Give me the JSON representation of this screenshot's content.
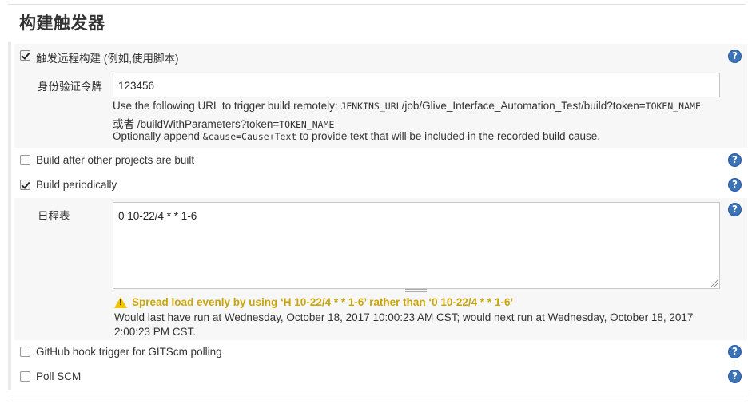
{
  "section": {
    "title": "构建触发器"
  },
  "remote_trigger": {
    "label": "触发远程构建 (例如,使用脚本)",
    "checked": true,
    "token_label": "身份验证令牌",
    "token_value": "123456",
    "desc_line1_prefix": "Use the following URL to trigger build remotely: ",
    "desc_line1_mono": "JENKINS_URL",
    "desc_line1_mid": "/job/Glive_Interface_Automation_Test/build?token=",
    "desc_line1_mono2": "TOKEN_NAME",
    "desc_line2_prefix": "或者 /buildWithParameters?token=",
    "desc_line2_mono": "TOKEN_NAME",
    "desc_line3_prefix": "Optionally append ",
    "desc_line3_mono": "&cause=Cause+Text",
    "desc_line3_suffix": " to provide text that will be included in the recorded build cause."
  },
  "build_after": {
    "label": "Build after other projects are built",
    "checked": false
  },
  "build_periodically": {
    "label": "Build periodically",
    "checked": true,
    "schedule_label": "日程表",
    "schedule_value": "0 10-22/4 * * 1-6",
    "warning": "Spread load evenly by using ‘H 10-22/4 * * 1-6’ rather than ‘0 10-22/4 * * 1-6’",
    "info_line1": "Would last have run at Wednesday, October 18, 2017 10:00:23 AM CST; would next run at Wednesday, October 18, 2017",
    "info_line2": "2:00:23 PM CST."
  },
  "github_hook": {
    "label": "GitHub hook trigger for GITScm polling",
    "checked": false
  },
  "poll_scm": {
    "label": "Poll SCM",
    "checked": false
  },
  "help": {
    "glyph": "?"
  },
  "icons": {
    "help": "help-icon",
    "warning": "warning-icon",
    "checkbox": "checkbox"
  },
  "colors": {
    "help_blue": "#3b73b9",
    "warning_text": "#c9a50a",
    "warning_icon": "#f5c400",
    "shade": "#f7f7f7"
  }
}
